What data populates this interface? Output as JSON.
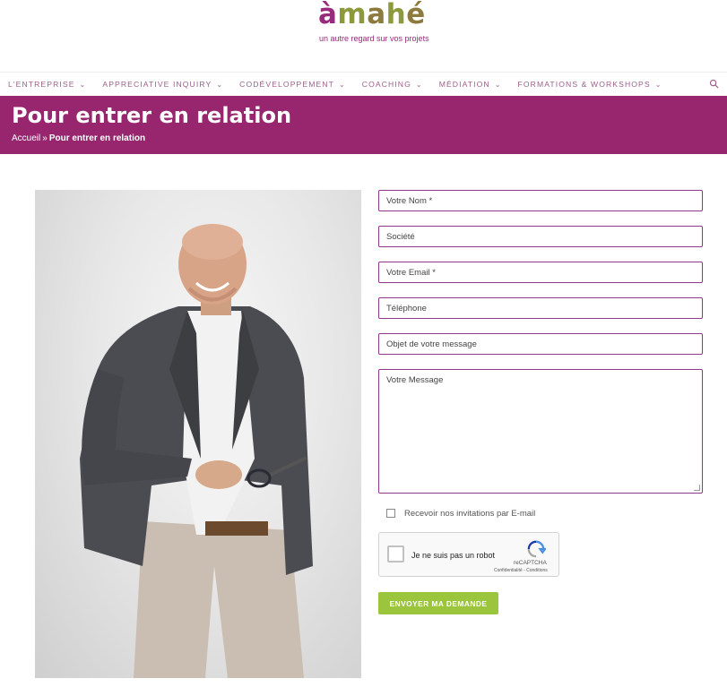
{
  "brand": {
    "logo_text": "àmahé",
    "tagline": "un autre regard sur vos projets",
    "colors": {
      "primary": "#97266f",
      "accent_green": "#9bc53d",
      "logo_olive": "#8c7b3c"
    }
  },
  "nav": {
    "items": [
      {
        "label": "L'ENTREPRISE",
        "icon": "chevron-down-icon"
      },
      {
        "label": "APPRECIATIVE INQUIRY",
        "icon": "chevron-down-icon"
      },
      {
        "label": "CODÉVELOPPEMENT",
        "icon": "chevron-down-icon"
      },
      {
        "label": "COACHING",
        "icon": "chevron-down-icon"
      },
      {
        "label": "MÉDIATION",
        "icon": "chevron-down-icon"
      },
      {
        "label": "FORMATIONS & WORKSHOPS",
        "icon": "chevron-down-icon"
      }
    ],
    "search_icon": "search-icon"
  },
  "hero": {
    "title": "Pour entrer en relation",
    "breadcrumb": {
      "home": "Accueil",
      "separator": "»",
      "current": "Pour entrer en relation"
    }
  },
  "form": {
    "fields": [
      {
        "placeholder": "Votre Nom *"
      },
      {
        "placeholder": "Société"
      },
      {
        "placeholder": "Votre Email *"
      },
      {
        "placeholder": "Téléphone"
      },
      {
        "placeholder": "Objet de votre message"
      }
    ],
    "message_placeholder": "Votre Message",
    "newsletter_label": "Recevoir nos invitations par E-mail",
    "captcha": {
      "label": "Je ne suis pas un robot",
      "brand": "reCAPTCHA",
      "links": "Confidentialité - Conditions"
    },
    "submit_label": "ENVOYER MA DEMANDE"
  }
}
